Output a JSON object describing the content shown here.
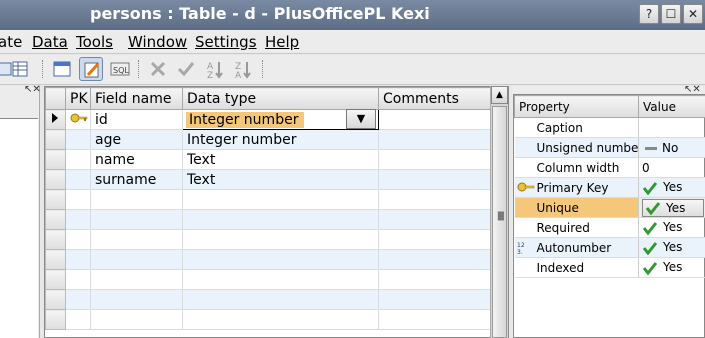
{
  "window": {
    "title": "persons : Table - d - PlusOfficePL Kexi",
    "buttons": [
      "?",
      "_",
      "☐",
      "✕"
    ]
  },
  "menu": [
    {
      "label": "ate",
      "key": "edit"
    },
    {
      "label": "Data",
      "key": "data"
    },
    {
      "label": "Tools",
      "key": "tools"
    },
    {
      "label": "Window",
      "key": "window"
    },
    {
      "label": "Settings",
      "key": "settings"
    },
    {
      "label": "Help",
      "key": "help"
    }
  ],
  "toolbar": {
    "sql_label": "SQL"
  },
  "grid": {
    "headers": {
      "pk": "PK",
      "field": "Field name",
      "type": "Data type",
      "comments": "Comments"
    },
    "rows": [
      {
        "field": "id",
        "type": "Integer number",
        "comments": "",
        "pk": true,
        "current": true
      },
      {
        "field": "age",
        "type": "Integer number",
        "comments": ""
      },
      {
        "field": "name",
        "type": "Text",
        "comments": ""
      },
      {
        "field": "surname",
        "type": "Text",
        "comments": ""
      }
    ],
    "empty_rows": 7
  },
  "properties": {
    "headers": {
      "name": "Property",
      "value": "Value"
    },
    "rows": [
      {
        "name": "Caption",
        "value": ""
      },
      {
        "name": "Unsigned number",
        "value": "No",
        "value_icon": "dash"
      },
      {
        "name": "Column width",
        "value": "0"
      },
      {
        "name": "Primary Key",
        "value": "Yes",
        "value_icon": "check",
        "icon": "key-icon"
      },
      {
        "name": "Unique",
        "value": "Yes",
        "value_icon": "check",
        "selected": true
      },
      {
        "name": "Required",
        "value": "Yes",
        "value_icon": "check"
      },
      {
        "name": "Autonumber",
        "value": "Yes",
        "value_icon": "check",
        "icon": "autonumber-icon"
      },
      {
        "name": "Indexed",
        "value": "Yes",
        "value_icon": "check"
      }
    ]
  },
  "colors": {
    "titlebar": "#6b7b93",
    "current_cell": "#f4c77a",
    "alt_row": "#eaf3fb",
    "check": "#2f9a2f"
  }
}
